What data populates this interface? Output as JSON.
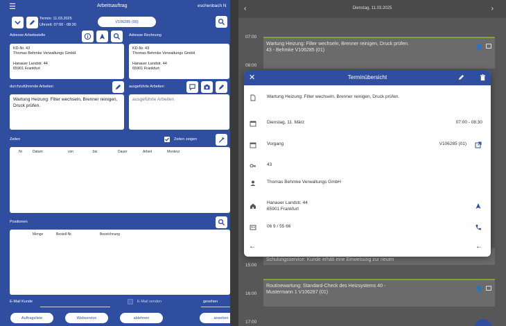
{
  "left": {
    "title": "Arbeitsauftrag",
    "company_cut": "eschenbach N",
    "termin": "Termin: 11.03.2025",
    "uhrzeit": "Uhrzeit: 07:00 - 08:30",
    "order_pill": "V106285 (00)",
    "adresse_arbeitsstelle_label": "Adresse Arbeitsstelle",
    "adresse_rechnung_label": "Adresse Rechnung",
    "addr1": {
      "kd": "KD-Nr. 43",
      "name": "Thomas Behmke Verwaltungs GmbH",
      "street": "Hanauer Landstr. 44",
      "city": "65901 Frankfurt"
    },
    "addr2": {
      "kd": "KD-Nr. 43",
      "name": "Thomas Behmke Verwaltungs GmbH",
      "street": "Hanauer Landstr. 44",
      "city": "65901 Frankfurt"
    },
    "durchzufuehrende_label": "durchzuführende Arbeiten",
    "ausgefuehrte_label": "ausgeführte Arbeiten",
    "work_text": "Wartung Heizung: Filter wechseln, Brenner reinigen, Druck prüfen.",
    "ausgefuehrte_placeholder": "ausgeführte Arbeiten",
    "zeiten_label": "Zeiten",
    "zeiten_zeigen": "Zeiten zeigen",
    "zeiten_cols": [
      "Nr",
      "Datum",
      "von",
      "bis",
      "Dauer",
      "Arbeit",
      "Monteur"
    ],
    "positionen_label": "Positionen",
    "positionen_cols": [
      "Menge",
      "Bestell-Nr.",
      "Bezeichnung"
    ],
    "email_label": "E-Mail Kunde",
    "email_senden": "E-Mail senden",
    "gesehen": "gesehen",
    "buttons": [
      "Auftragsliste",
      "Webservice",
      "ablehnen",
      "ansehen"
    ]
  },
  "right": {
    "date": "Dienstag, 11.03.2025",
    "times": [
      "07:00",
      "08:00",
      "15:00",
      "16:00",
      "17:00"
    ],
    "appt1_line1": "Wartung Heizung: Filter wechseln, Brenner reinigen, Druck prüfen.",
    "appt1_line2": "43 - Behmke V106285 (01)",
    "appt2": "Schulungsservice: Kunde erhält eine Einweisung zur neuen",
    "appt3_line1": "Routinewartung: Standard-Check des Heizsystems 40 -",
    "appt3_line2": "Mustermann 1 V106287 (01)"
  },
  "dialog": {
    "title": "Terminübersicht",
    "description": "Wartung Heizung: Filter wechseln, Brenner reinigen, Druck prüfen.",
    "date": "Dienstag, 11. März",
    "time": "07:00 - 08:30",
    "vorgang_label": "Vorgang",
    "vorgang_value": "V106285 (01)",
    "kd": "43",
    "customer": "Thomas Behmke Verwaltungs GmbH",
    "street": "Hanauer Landstr. 44",
    "city": "65901 Frankfurt",
    "phone": "06 9 / 55 66"
  }
}
